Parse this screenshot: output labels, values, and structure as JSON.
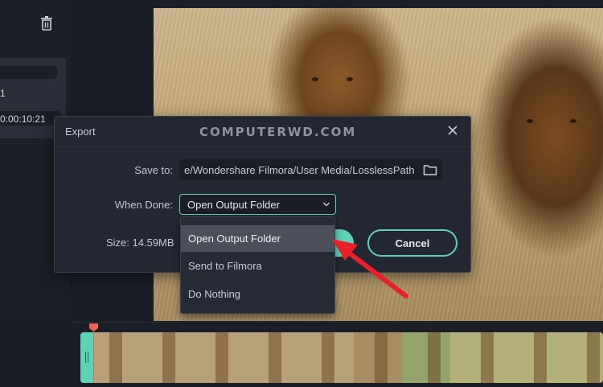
{
  "dialog": {
    "title": "Export",
    "watermark": "COMPUTERWD.COM",
    "save_to_label": "Save to:",
    "save_to_path": "e/Wondershare Filmora/User Media/LosslessPath",
    "when_done_label": "When Done:",
    "when_done_value": "Open Output Folder",
    "size_label": "Size: 14.59MB",
    "cancel_label": "Cancel"
  },
  "dropdown": {
    "options": [
      "Open Output Folder",
      "Send to Filmora",
      "Do Nothing"
    ],
    "selected_index": 0
  },
  "left_panel": {
    "clip_number": "1",
    "clip_duration": "0:00:10:21"
  },
  "colors": {
    "accent": "#5fd1b7",
    "annotation_arrow": "#e8202a",
    "playhead": "#f0604e",
    "dialog_bg": "#232731"
  },
  "icons": {
    "delete": "trash-icon",
    "close": "close-icon",
    "browse": "folder-icon",
    "expand": "chevron-down-icon"
  }
}
